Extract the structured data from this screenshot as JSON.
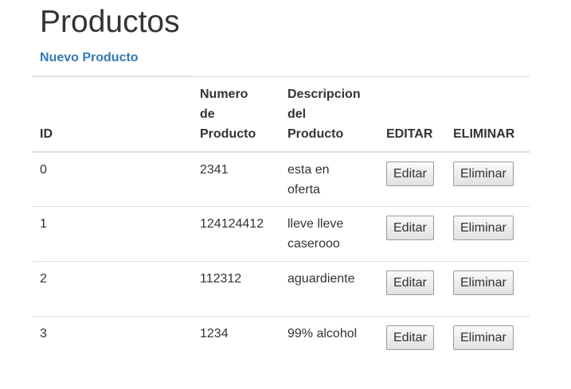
{
  "page": {
    "title": "Productos",
    "new_link": "Nuevo Producto"
  },
  "table": {
    "headers": {
      "id": "ID",
      "numero_1": "Numero",
      "numero_2": "de",
      "numero_3": "Producto",
      "desc_1": "Descripcion",
      "desc_2": "del",
      "desc_3": "Producto",
      "editar": "EDITAR",
      "eliminar": "ELIMINAR"
    },
    "rows": [
      {
        "id": "0",
        "numero": "2341",
        "desc_1": "esta en",
        "desc_2": "oferta",
        "edit_label": "Editar",
        "delete_label": "Eliminar"
      },
      {
        "id": "1",
        "numero": "124124412",
        "desc_1": "lleve lleve",
        "desc_2": "caserooo",
        "edit_label": "Editar",
        "delete_label": "Eliminar"
      },
      {
        "id": "2",
        "numero": "112312",
        "desc_1": "aguardiente",
        "desc_2": "",
        "edit_label": "Editar",
        "delete_label": "Eliminar"
      },
      {
        "id": "3",
        "numero": "1234",
        "desc_1": "99% alcohol",
        "desc_2": "",
        "edit_label": "Editar",
        "delete_label": "Eliminar"
      }
    ]
  }
}
